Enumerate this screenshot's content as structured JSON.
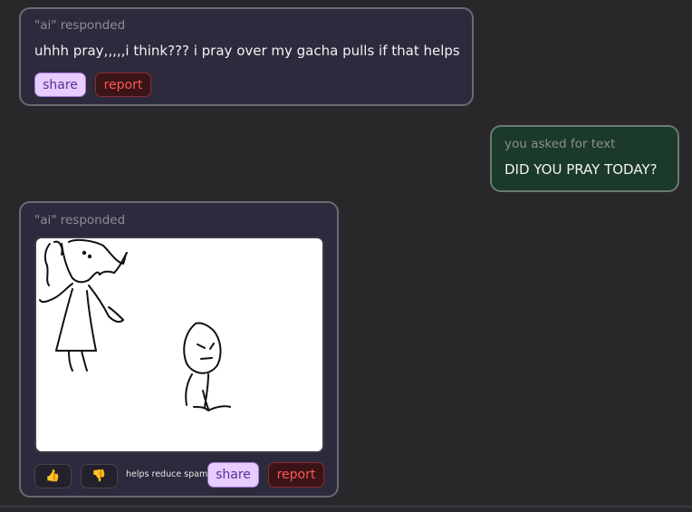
{
  "messages": [
    {
      "meta": "\"ai\" responded",
      "text": "uhhh pray,,,,,i think??? i pray over my gacha pulls if that helps",
      "share_label": "share",
      "report_label": "report"
    },
    {
      "meta": "you asked for text",
      "text": "DID YOU PRAY TODAY?"
    },
    {
      "meta": "\"ai\" responded",
      "thumb_up": "👍",
      "thumb_down": "👎",
      "spam_note": "helps reduce spam",
      "share_label": "share",
      "report_label": "report"
    }
  ],
  "colors": {
    "background": "#282729",
    "ai_bubble": "#2d2a3d",
    "user_bubble": "#1c3a2a",
    "share_bg": "#e6ccff",
    "report_text": "#ff5656"
  }
}
